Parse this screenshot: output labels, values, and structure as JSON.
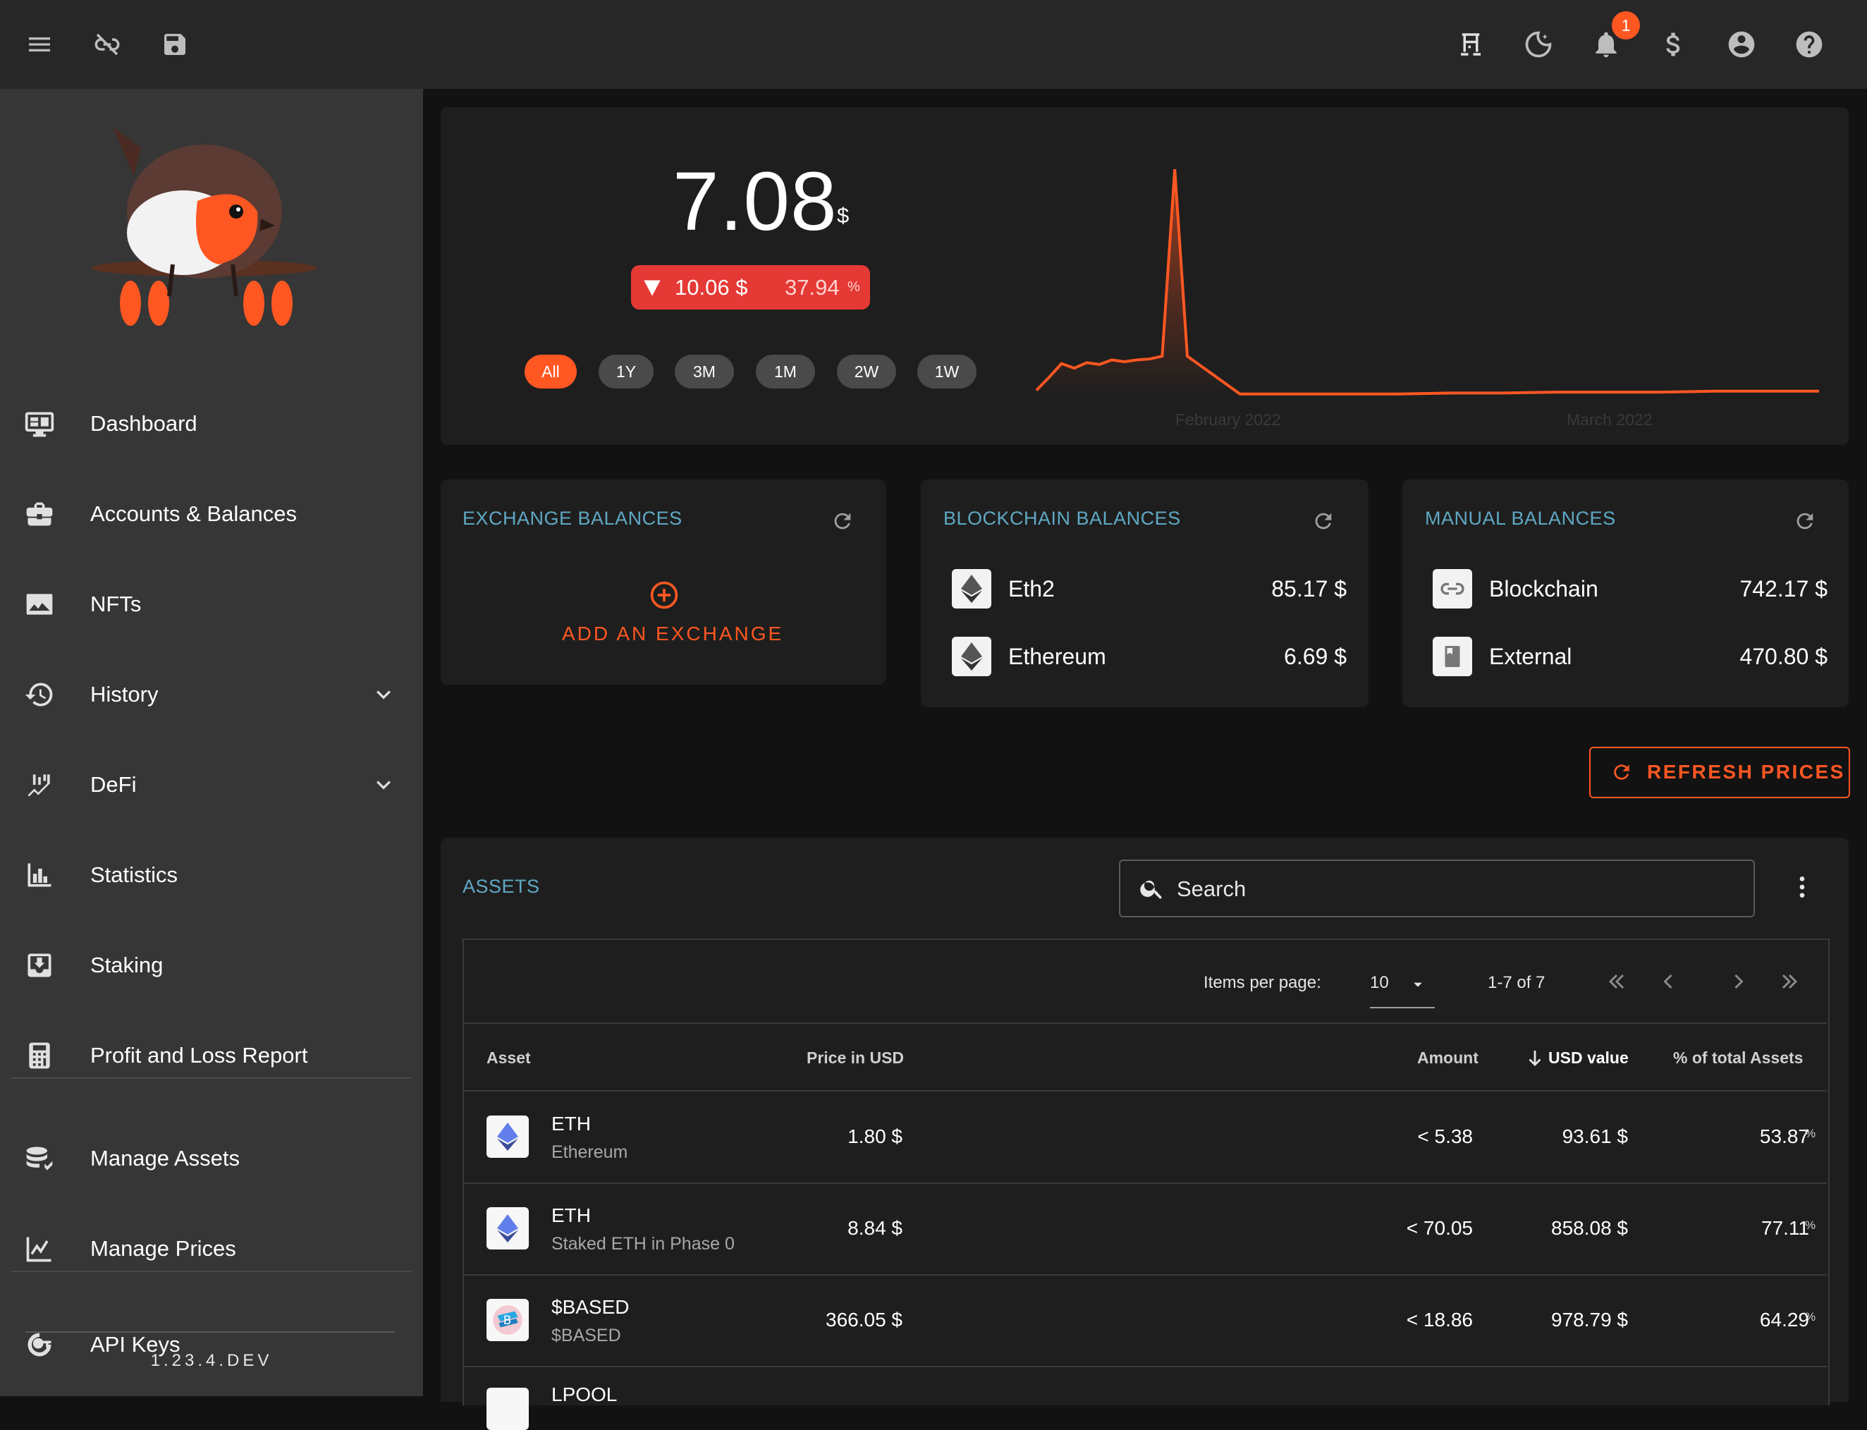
{
  "topbar": {
    "icons": [
      "menu-icon",
      "link-off-icon",
      "save-icon",
      "lamp-icon",
      "theme-icon",
      "bell-icon",
      "dollar-icon",
      "account-icon",
      "help-icon"
    ],
    "notification_count": "1"
  },
  "sidebar": {
    "items": [
      {
        "label": "Dashboard",
        "icon": "monitor-icon"
      },
      {
        "label": "Accounts & Balances",
        "icon": "briefcase-icon"
      },
      {
        "label": "NFTs",
        "icon": "image-icon"
      },
      {
        "label": "History",
        "icon": "history-icon",
        "expandable": true
      },
      {
        "label": "DeFi",
        "icon": "defi-chart-icon",
        "expandable": true
      },
      {
        "label": "Statistics",
        "icon": "bar-chart-icon"
      },
      {
        "label": "Staking",
        "icon": "inbox-icon"
      },
      {
        "label": "Profit and Loss Report",
        "icon": "calculator-icon"
      },
      {
        "label": "Manage Assets",
        "icon": "coins-icon"
      },
      {
        "label": "Manage Prices",
        "icon": "line-chart-icon"
      },
      {
        "label": "API Keys",
        "icon": "key-icon"
      }
    ],
    "version": "1.23.4.DEV"
  },
  "overview": {
    "total_value": "7.08",
    "currency_symbol": "$",
    "change_amount": "10.06 $",
    "change_percent": "37.94",
    "percent_symbol": "%",
    "change_direction": "down",
    "ranges": [
      "All",
      "1Y",
      "3M",
      "1M",
      "2W",
      "1W"
    ],
    "active_range": "All",
    "accent_color": "#ff5722",
    "negative_color": "#e53935"
  },
  "chart_data": {
    "type": "area",
    "x_tick_labels": [
      "February 2022",
      "March 2022"
    ],
    "series": [
      {
        "values": [
          0.5,
          1.9,
          3.4,
          2.9,
          3.5,
          3.3,
          3.8,
          3.6,
          3.8,
          3.9,
          4.2,
          24.5,
          4.2,
          0.1,
          0.1,
          0.1,
          0.1,
          0.2,
          0.2,
          0.3,
          0.3,
          0.3,
          0.4,
          0.4,
          0.4
        ]
      }
    ],
    "line_color": "#ff5722"
  },
  "exchange_balances": {
    "title": "EXCHANGE BALANCES",
    "add_label": "ADD AN EXCHANGE"
  },
  "blockchain_balances": {
    "title": "BLOCKCHAIN BALANCES",
    "rows": [
      {
        "name": "Eth2",
        "value": "85.17 $",
        "icon": "eth-icon"
      },
      {
        "name": "Ethereum",
        "value": "6.69 $",
        "icon": "eth-icon"
      }
    ]
  },
  "manual_balances": {
    "title": "MANUAL BALANCES",
    "rows": [
      {
        "name": "Blockchain",
        "value": "742.17 $",
        "icon": "link-icon"
      },
      {
        "name": "External",
        "value": "470.80 $",
        "icon": "book-icon"
      }
    ]
  },
  "refresh_prices_label": "REFRESH PRICES",
  "assets": {
    "title": "ASSETS",
    "search_placeholder": "Search",
    "pagination": {
      "items_per_page_label": "Items per page:",
      "items_per_page": "10",
      "range": "1-7 of 7"
    },
    "columns": [
      "Asset",
      "Price in USD",
      "Amount",
      "USD value",
      "% of total Assets"
    ],
    "sorted_column": "USD value",
    "rows": [
      {
        "symbol": "ETH",
        "name": "Ethereum",
        "price": "1.80 $",
        "amount": "< 5.38",
        "usd_value": "93.61 $",
        "percent": "53.87",
        "icon": "eth-icon"
      },
      {
        "symbol": "ETH",
        "name": "Staked ETH in Phase 0",
        "price": "8.84 $",
        "amount": "< 70.05",
        "usd_value": "858.08 $",
        "percent": "77.11",
        "icon": "eth-icon"
      },
      {
        "symbol": "$BASED",
        "name": "$BASED",
        "price": "366.05 $",
        "amount": "< 18.86",
        "usd_value": "978.79 $",
        "percent": "64.29",
        "icon": "based-icon"
      },
      {
        "symbol": "LPOOL",
        "name": "",
        "price": "",
        "amount": "",
        "usd_value": "",
        "percent": "",
        "icon": "token-icon"
      }
    ]
  }
}
